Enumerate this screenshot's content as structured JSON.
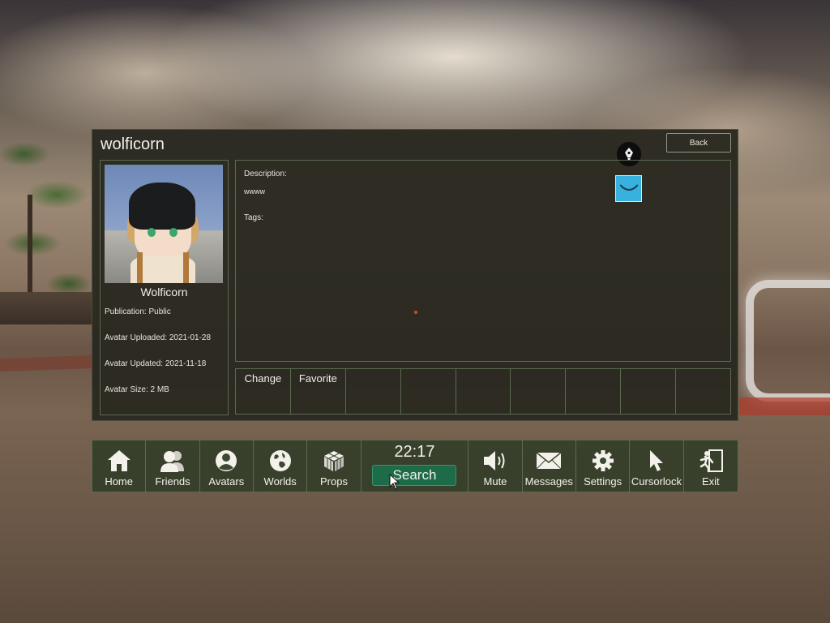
{
  "window": {
    "title": "wolficorn",
    "back_label": "Back"
  },
  "avatar": {
    "name": "Wolficorn",
    "info": [
      "Publication: Public",
      "Avatar Uploaded: 2021-01-28",
      "Avatar Updated: 2021-11-18",
      "Avatar Size: 2 MB"
    ]
  },
  "details": {
    "description_label": "Description:",
    "description_text": "wwww",
    "tags_label": "Tags:"
  },
  "actions": [
    "Change",
    "Favorite",
    "",
    "",
    "",
    "",
    "",
    "",
    ""
  ],
  "dock": {
    "clock": "22:17",
    "search_label": "Search",
    "left_items": [
      {
        "label": "Home",
        "icon": "home-icon"
      },
      {
        "label": "Friends",
        "icon": "friends-icon"
      },
      {
        "label": "Avatars",
        "icon": "avatar-icon"
      },
      {
        "label": "Worlds",
        "icon": "globe-icon"
      },
      {
        "label": "Props",
        "icon": "cube-icon"
      }
    ],
    "right_items": [
      {
        "label": "Mute",
        "icon": "speaker-icon"
      },
      {
        "label": "Messages",
        "icon": "envelope-icon"
      },
      {
        "label": "Settings",
        "icon": "gear-icon"
      },
      {
        "label": "Cursorlock",
        "icon": "cursor-icon"
      },
      {
        "label": "Exit",
        "icon": "exit-icon"
      }
    ]
  },
  "colors": {
    "search_button": "#1e6b4a",
    "panel_border": "#5b6a50",
    "blue_tile": "#37b2df"
  }
}
